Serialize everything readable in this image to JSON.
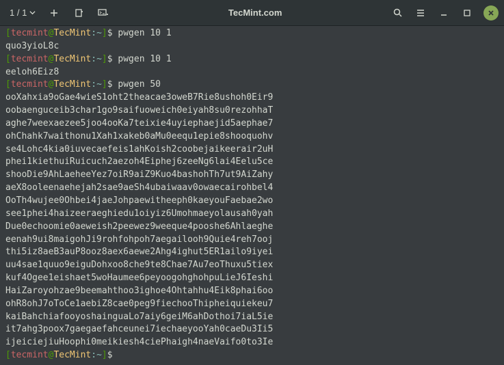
{
  "titlebar": {
    "tab_counter": "1 / 1",
    "title": "TecMint.com"
  },
  "prompt": {
    "user": "tecmint",
    "at": "@",
    "host": "TecMint",
    "path": ":~",
    "dollar": "$"
  },
  "lines": [
    {
      "type": "prompt",
      "cmd": "pwgen 10 1"
    },
    {
      "type": "output",
      "text": "quo3yioL8c"
    },
    {
      "type": "prompt",
      "cmd": "pwgen 10 1"
    },
    {
      "type": "output",
      "text": "eeloh6Eiz8"
    },
    {
      "type": "prompt",
      "cmd": "pwgen 50"
    },
    {
      "type": "output",
      "text": "ooXahxia9oGae4wieS1oht2theacae3oweB7Rie8ushoh0Eir9"
    },
    {
      "type": "output",
      "text": "oobaenguceib3char1go9saifuoweich0eiyah8su0rezohhaT"
    },
    {
      "type": "output",
      "text": "aghe7weexaezee5joo4ooKa7teixie4uyiephaejid5aephae7"
    },
    {
      "type": "output",
      "text": "ohChahk7waithonu1Xah1xakeb0aMu0eequ1epie8shooquohv"
    },
    {
      "type": "output",
      "text": "se4Lohc4kia0iuvecaefeis1ahKoish2coobejaikeerair2uH"
    },
    {
      "type": "output",
      "text": "phei1kiethuiRuicuch2aezoh4Eiphej6zeeNg6lai4Eelu5ce"
    },
    {
      "type": "output",
      "text": "shooDie9AhLaeheeYez7oiR9aiZ9Kuo4bashohTh7ut9AiZahy"
    },
    {
      "type": "output",
      "text": "aeX8ooleenaehejah2sae9aeSh4ubaiwaav0owaecairohbel4"
    },
    {
      "type": "output",
      "text": "OoTh4wujee0Ohbei4jaeJohpaewitheeph0kaeyouFaebae2wo"
    },
    {
      "type": "output",
      "text": "see1phei4haizeeraeghiedu1oiyiz6Umohmaeyolausah0yah"
    },
    {
      "type": "output",
      "text": "Due0echoomie0aeweish2peewez9weeque4pooshe6Ahlaeghe"
    },
    {
      "type": "output",
      "text": "eenah9ui8maigohJi9rohfohpoh7aegailooh9Quie4reh7ooj"
    },
    {
      "type": "output",
      "text": "thi5iz8aeB3auP8ooz8aex6aewe2Ahg4ighut5ER1ailo9iyei"
    },
    {
      "type": "output",
      "text": "uu4sae1quuo9eiguDohxoo8che9te8Chae7Au7eoThuxu5tiex"
    },
    {
      "type": "output",
      "text": "kuf4Ogee1eishaet5woHaumee6peyoogohghohpuLieJ6Ieshi"
    },
    {
      "type": "output",
      "text": "HaiZaroyohzae9beemahthoo3ighoe4Ohtahhu4Eik8phai6oo"
    },
    {
      "type": "output",
      "text": "ohR8ohJ7oToCe1aebiZ8cae0peg9fiechooThipheiquiekeu7"
    },
    {
      "type": "output",
      "text": "kaiBahchiafooyoshainguaLo7aiy6geiM6ahDothoi7iaL5ie"
    },
    {
      "type": "output",
      "text": "it7ahg3poox7gaegaefahceunei7iechaeyooYah0caeDu3Ii5"
    },
    {
      "type": "output",
      "text": "ijeiciejiuHoophi0meikiesh4ciePhaigh4naeVaifo0to3Ie"
    },
    {
      "type": "prompt",
      "cmd": ""
    }
  ]
}
